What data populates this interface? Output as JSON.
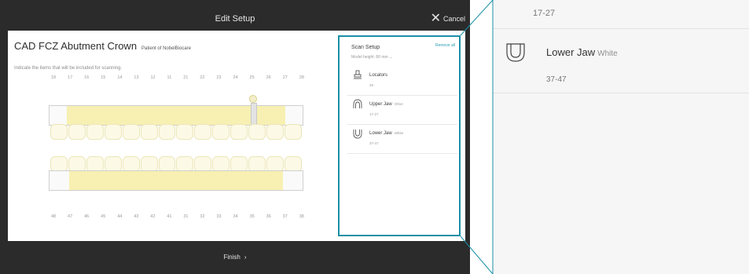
{
  "header": {
    "title": "Edit Setup",
    "cancel_label": "Cancel"
  },
  "case": {
    "title": "CAD FCZ Abutment Crown",
    "patient": "Patient of NobelBiocare"
  },
  "instruction": "Indicate the items that will be included for scanning.",
  "upper_teeth_numbers": [
    "18",
    "17",
    "16",
    "15",
    "14",
    "13",
    "12",
    "11",
    "21",
    "22",
    "23",
    "24",
    "25",
    "26",
    "27",
    "28"
  ],
  "lower_teeth_numbers": [
    "48",
    "47",
    "46",
    "45",
    "44",
    "43",
    "42",
    "41",
    "31",
    "32",
    "33",
    "34",
    "35",
    "36",
    "37",
    "38"
  ],
  "scan_setup": {
    "title": "Scan Setup",
    "remove_all": "Remove all",
    "model_height_label": "Model height: 80 mm",
    "items": [
      {
        "name": "Locators",
        "shade": "",
        "range": "26",
        "icon": "locator-icon"
      },
      {
        "name": "Upper Jaw",
        "shade": "Other",
        "range": "17-27",
        "icon": "upper-jaw-icon"
      },
      {
        "name": "Lower Jaw",
        "shade": "White",
        "range": "37-47",
        "icon": "lower-jaw-icon"
      }
    ]
  },
  "footer": {
    "finish_label": "Finish"
  },
  "zoom_panel": {
    "upper_range": "17-27",
    "lower": {
      "name": "Lower Jaw",
      "shade": "White",
      "range": "37-47"
    }
  },
  "colors": {
    "accent": "#1a8fa6",
    "selection": "#f7f0b2",
    "dark_bar": "#2b2b2b"
  }
}
